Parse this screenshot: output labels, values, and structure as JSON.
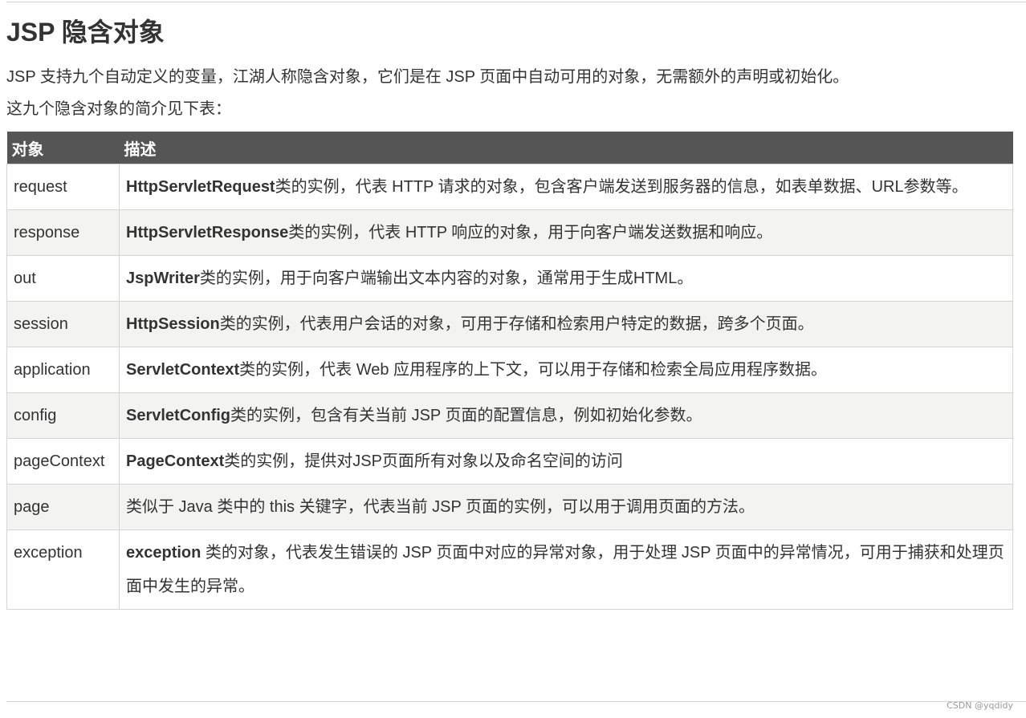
{
  "title": "JSP 隐含对象",
  "intro": {
    "line1": "JSP 支持九个自动定义的变量，江湖人称隐含对象，它们是在 JSP 页面中自动可用的对象，无需额外的声明或初始化。",
    "line2": "这九个隐含对象的简介见下表："
  },
  "table": {
    "headers": {
      "object": "对象",
      "description": "描述"
    },
    "rows": [
      {
        "object": "request",
        "bold": "HttpServletRequest",
        "text": "类的实例，代表 HTTP 请求的对象，包含客户端发送到服务器的信息，如表单数据、URL参数等。"
      },
      {
        "object": "response",
        "bold": "HttpServletResponse",
        "text": "类的实例，代表 HTTP 响应的对象，用于向客户端发送数据和响应。"
      },
      {
        "object": "out",
        "bold": "JspWriter",
        "text": "类的实例，用于向客户端输出文本内容的对象，通常用于生成HTML。"
      },
      {
        "object": "session",
        "bold": "HttpSession",
        "text": "类的实例，代表用户会话的对象，可用于存储和检索用户特定的数据，跨多个页面。"
      },
      {
        "object": "application",
        "bold": "ServletContext",
        "text": "类的实例，代表 Web 应用程序的上下文，可以用于存储和检索全局应用程序数据。"
      },
      {
        "object": "config",
        "bold": "ServletConfig",
        "text": "类的实例，包含有关当前 JSP 页面的配置信息，例如初始化参数。"
      },
      {
        "object": "pageContext",
        "bold": "PageContext",
        "text": "类的实例，提供对JSP页面所有对象以及命名空间的访问"
      },
      {
        "object": "page",
        "bold": "",
        "text": "类似于 Java 类中的 this 关键字，代表当前 JSP 页面的实例，可以用于调用页面的方法。"
      },
      {
        "object": "exception",
        "bold": "exception",
        "text": " 类的对象，代表发生错误的 JSP 页面中对应的异常对象，用于处理 JSP 页面中的异常情况，可用于捕获和处理页面中发生的异常。"
      }
    ]
  },
  "watermark": "CSDN @yqdidy"
}
